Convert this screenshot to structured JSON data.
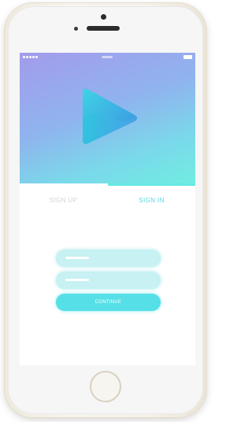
{
  "tabs": {
    "signup_label": "SIGN UP",
    "signin_label": "SIGN IN",
    "active": "signin"
  },
  "form": {
    "continue_label": "CONTINUE"
  },
  "icons": {
    "logo": "play-logo-icon",
    "home": "home-button"
  },
  "colors": {
    "accent": "#56dfe6",
    "hero_gradient_start": "#a39bec",
    "hero_gradient_end": "#6fede0",
    "inactive_tab": "#cfd3d8"
  }
}
